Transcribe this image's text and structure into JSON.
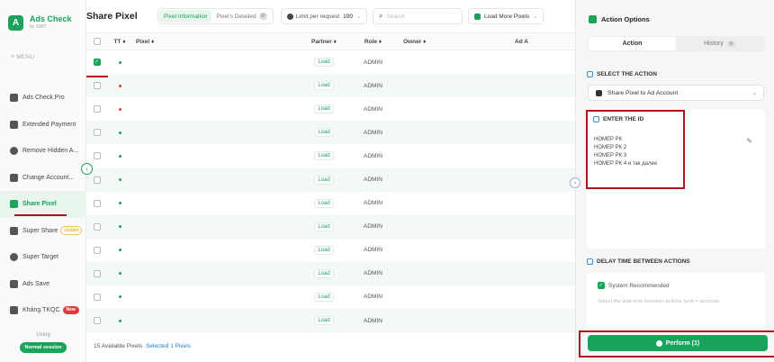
{
  "brand": {
    "logo": "A",
    "title": "Ads Check",
    "subtitle": "by SMIT"
  },
  "sidebar": {
    "menu_label": "≡ MENU",
    "items": [
      {
        "label": "Ads Check Pro",
        "icon": "chart-icon"
      },
      {
        "label": "Extended Payment",
        "icon": "card-icon"
      },
      {
        "label": "Remove Hidden A...",
        "icon": "eye-icon"
      },
      {
        "label": "Change Account...",
        "icon": "file-icon"
      },
      {
        "label": "Share Pixel",
        "icon": "pixel-icon",
        "active": true
      },
      {
        "label": "Super Share",
        "icon": "share-icon",
        "badge": "Update"
      },
      {
        "label": "Super Target",
        "icon": "target-icon"
      },
      {
        "label": "Ads Save",
        "icon": "save-icon"
      },
      {
        "label": "Kháng TKQC",
        "icon": "shield-icon",
        "badge": "New"
      }
    ],
    "using_label": "Using",
    "session_label": "Normal session"
  },
  "header": {
    "title": "Share Pixel",
    "tabs": [
      {
        "label": "Pixel Information",
        "active": true
      },
      {
        "label": "Pixel's Detailed",
        "count": "0"
      }
    ],
    "limit_label": "Limit per request",
    "limit_value": "100",
    "search_placeholder": "Search",
    "load_more_label": "Load More Pixels"
  },
  "table": {
    "columns": {
      "tt": "TT ♦",
      "pixel": "Pixel ♦",
      "partner": "Partner ♦",
      "role": "Role ♦",
      "owner": "Owner ♦",
      "ad": "Ad A"
    },
    "rows": [
      {
        "checked": true,
        "status": "green",
        "partner": "Load",
        "role": "ADMIN"
      },
      {
        "checked": false,
        "status": "red",
        "partner": "Load",
        "role": "ADMIN"
      },
      {
        "checked": false,
        "status": "red",
        "partner": "Load",
        "role": "ADMIN"
      },
      {
        "checked": false,
        "status": "green",
        "partner": "Load",
        "role": "ADMIN"
      },
      {
        "checked": false,
        "status": "green",
        "partner": "Load",
        "role": "ADMIN"
      },
      {
        "checked": false,
        "status": "green",
        "partner": "Load",
        "role": "ADMIN"
      },
      {
        "checked": false,
        "status": "green",
        "partner": "Load",
        "role": "ADMIN"
      },
      {
        "checked": false,
        "status": "green",
        "partner": "Load",
        "role": "ADMIN"
      },
      {
        "checked": false,
        "status": "green",
        "partner": "Load",
        "role": "ADMIN"
      },
      {
        "checked": false,
        "status": "green",
        "partner": "Load",
        "role": "ADMIN"
      },
      {
        "checked": false,
        "status": "green",
        "partner": "Load",
        "role": "ADMIN"
      },
      {
        "checked": false,
        "status": "green",
        "partner": "Load",
        "role": "ADMIN"
      },
      {
        "checked": false,
        "status": "red",
        "partner": "Load",
        "role": "ADMIN"
      }
    ],
    "footer_available": "15 Available Pixels",
    "footer_selected": "Selected 1 Pixels"
  },
  "panel": {
    "title": "Action Options",
    "tabs": [
      {
        "label": "Action",
        "active": true
      },
      {
        "label": "History",
        "count": "0"
      }
    ],
    "select_action_label": "SELECT THE ACTION",
    "selected_action": "Share Pixel to Ad Account",
    "enter_id_label": "ENTER THE ID",
    "id_lines": [
      "НОМЕР РК",
      "НОМЕР РК 2",
      "НОМЕР РК 3",
      "НОМЕР РК 4 и так далее"
    ],
    "delay_label": "DELAY TIME BETWEEN ACTIONS",
    "system_recommended": "System Recommended",
    "delay_hint": "Select the wait time between actions (unit = seconds",
    "perform_label": "Perform (1)"
  },
  "colors": {
    "accent": "#1aa35b",
    "annotation": "#b1121a",
    "status_red": "#e23b3b"
  }
}
